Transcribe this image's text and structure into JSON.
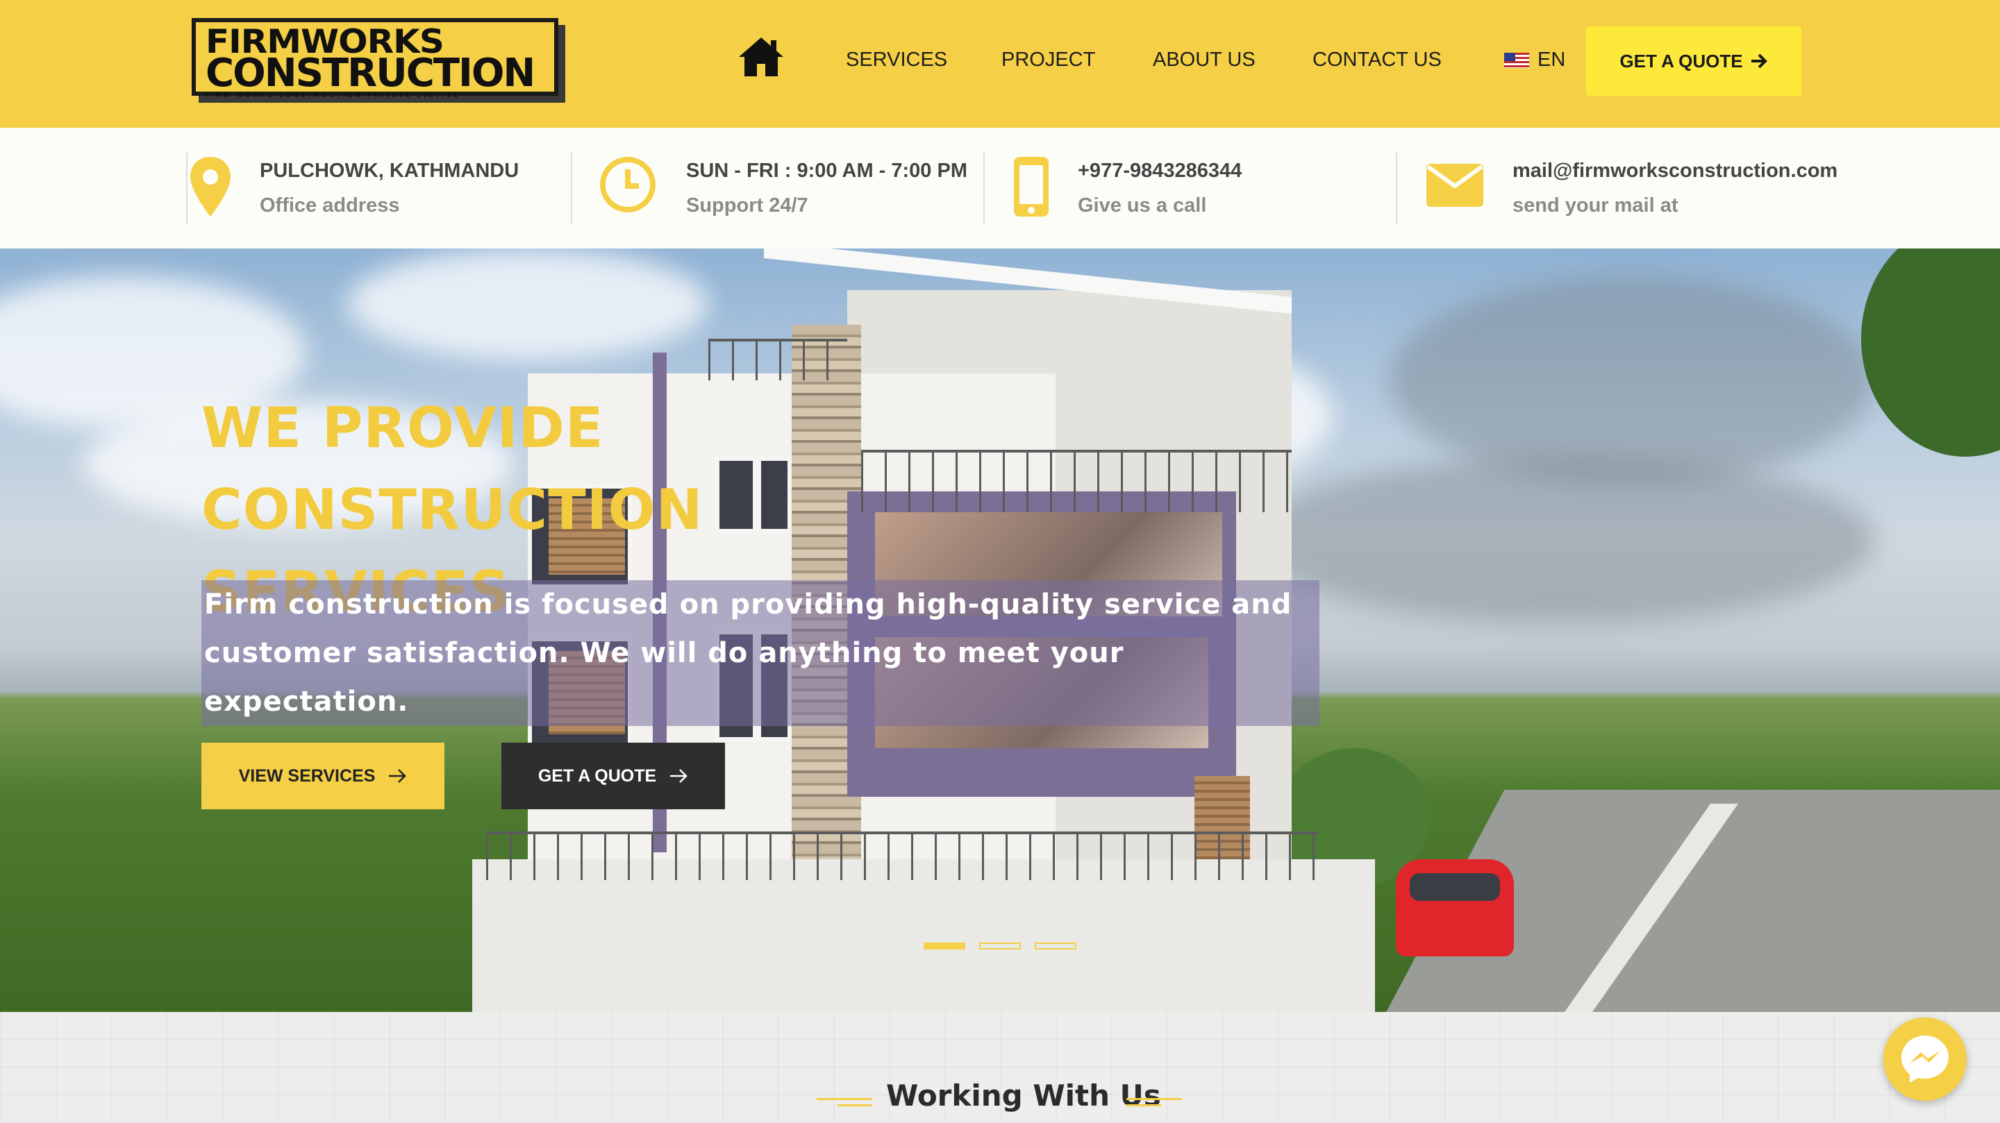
{
  "header": {
    "logo": {
      "line1": "FIRMWORKS",
      "line2": "CONSTRUCTION",
      "tagline": "FIRM WORKS CONSTRUCTION PRIVATE LIMITED"
    },
    "nav": [
      {
        "label": "SERVICES"
      },
      {
        "label": "PROJECT"
      },
      {
        "label": "ABOUT US"
      },
      {
        "label": "CONTACT US"
      }
    ],
    "language": "EN",
    "quote_button": "GET A QUOTE",
    "icons": {
      "home": "home-icon",
      "flag": "us-flag-icon",
      "arrow": "arrow-right-icon"
    },
    "brand_color": "#f5cf45"
  },
  "info": {
    "address": {
      "title": "PULCHOWK, KATHMANDU",
      "subtitle": "Office address",
      "icon": "map-pin-icon"
    },
    "hours": {
      "title": "SUN - FRI : 9:00 AM - 7:00 PM",
      "subtitle": "Support 24/7",
      "icon": "clock-icon"
    },
    "phone": {
      "title": "+977-9843286344",
      "subtitle": "Give us a call",
      "icon": "phone-icon"
    },
    "email": {
      "title": "mail@firmworksconstruction.com",
      "subtitle": "send your mail at",
      "icon": "envelope-icon"
    },
    "icon_color": "#f5cf45"
  },
  "hero": {
    "title_line1": "WE PROVIDE CONSTRUCTION",
    "title_line2": "SERVICES",
    "subtitle_line1": "Firm construction is focused on providing high-quality service and",
    "subtitle_line2": "customer satisfaction. We will do anything to meet your expectation.",
    "primary_button": "VIEW SERVICES",
    "secondary_button": "GET A QUOTE",
    "slides": 3,
    "active_slide": 1
  },
  "section": {
    "title": "Working With Us"
  },
  "chat": {
    "icon": "messenger-icon"
  }
}
